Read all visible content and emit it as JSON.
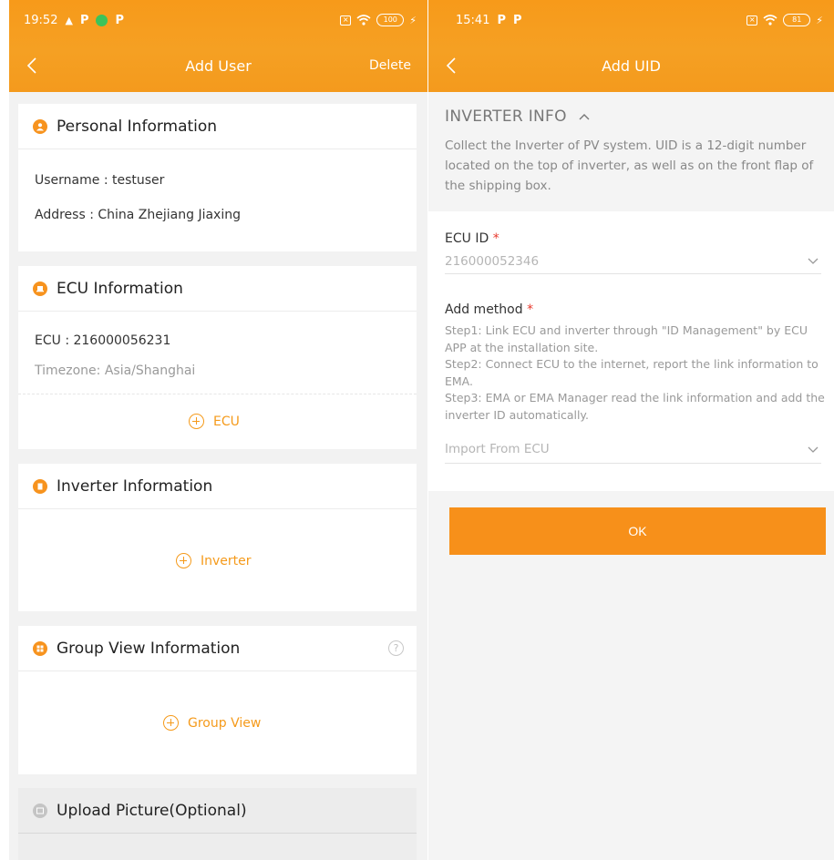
{
  "left": {
    "status": {
      "time": "19:52",
      "battery": "100"
    },
    "nav": {
      "title": "Add User",
      "delete": "Delete"
    },
    "personal": {
      "title": "Personal Information",
      "username": "Username : testuser",
      "address": "Address : China Zhejiang Jiaxing"
    },
    "ecu": {
      "title": "ECU Information",
      "ecu_line": "ECU : 216000056231",
      "timezone": "Timezone:  Asia/Shanghai",
      "add": "ECU"
    },
    "inverter": {
      "title": "Inverter Information",
      "add": "Inverter"
    },
    "group": {
      "title": "Group View Information",
      "help": "?",
      "add": "Group View"
    },
    "upload": {
      "title": "Upload Picture(Optional)"
    }
  },
  "right": {
    "status": {
      "time": "15:41",
      "battery": "81"
    },
    "nav": {
      "title": "Add UID"
    },
    "info": {
      "title": "INVERTER INFO",
      "desc": "Collect the Inverter of PV system. UID is a 12-digit number located on the top of inverter, as well as on the front flap of the shipping box."
    },
    "ecu_id": {
      "label": "ECU ID",
      "value": "216000052346"
    },
    "method": {
      "label": "Add method",
      "steps": [
        "Step1: Link ECU and inverter through \"ID Management\" by ECU APP at the installation site.",
        "Step2: Connect ECU to the internet, report the link information to EMA.",
        "Step3: EMA or EMA Manager read the link information and add the inverter ID automatically."
      ],
      "value": "Import From ECU"
    },
    "ok": "OK"
  },
  "required_mark": "*",
  "colors": {
    "accent": "#f7931e",
    "required": "#e8382c"
  }
}
